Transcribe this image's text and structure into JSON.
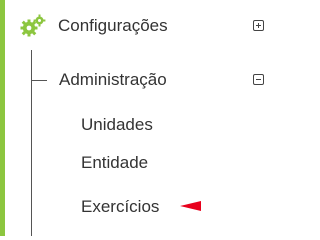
{
  "menu": {
    "top_item": {
      "label": "Configurações",
      "icon": "gears-icon",
      "toggle": "expand"
    },
    "group": {
      "label": "Administração",
      "toggle": "collapse"
    },
    "subitems": [
      {
        "label": "Unidades"
      },
      {
        "label": "Entidade"
      },
      {
        "label": "Exercícios"
      }
    ]
  },
  "colors": {
    "accent": "#8cc63f",
    "text": "#333333",
    "pointer": "#e8001c"
  },
  "annotation": {
    "icon": "red-arrow-pointer-icon"
  }
}
